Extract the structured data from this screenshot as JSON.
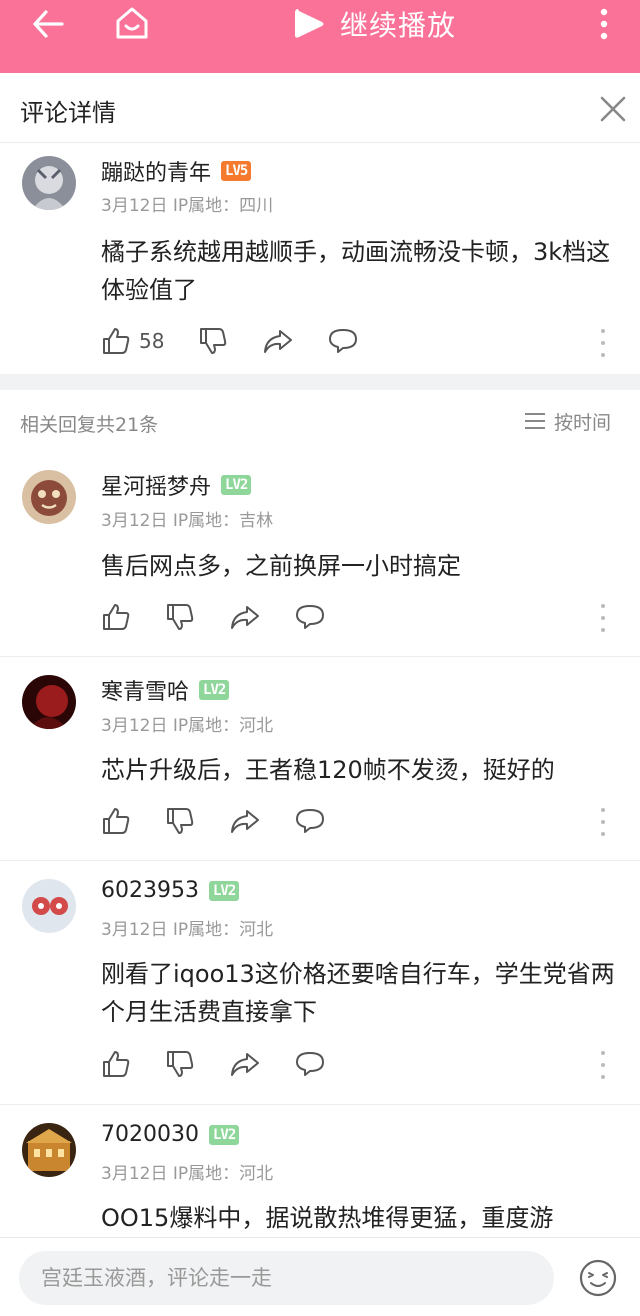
{
  "topbar": {
    "play_label": "继续播放"
  },
  "header": {
    "title": "评论详情"
  },
  "main_comment": {
    "username": "蹦跶的青年",
    "level": "LV5",
    "meta": "3月12日 IP属地：四川",
    "text": "橘子系统越用越顺手，动画流畅没卡顿，3k档这体验值了",
    "likes": "58"
  },
  "related": {
    "count_label": "相关回复共21条",
    "sort_label": "按时间"
  },
  "replies": [
    {
      "username": "星河摇梦舟",
      "level": "LV2",
      "meta": "3月12日 IP属地：吉林",
      "text": "售后网点多，之前换屏一小时搞定"
    },
    {
      "username": "寒青雪哈",
      "level": "LV2",
      "meta": "3月12日 IP属地：河北",
      "text": "芯片升级后，王者稳120帧不发烫，挺好的"
    },
    {
      "username": "6023953",
      "level": "LV2",
      "meta": "3月12日 IP属地：河北",
      "text": "刚看了iqoo13这价格还要啥自行车，学生党省两个月生活费直接拿下"
    },
    {
      "username": "7020030",
      "level": "LV2",
      "meta": "3月12日 IP属地：河北",
      "text": "OO15爆料中，据说散热堆得更猛，重度游"
    }
  ],
  "input": {
    "placeholder": "宫廷玉液酒，评论走一走"
  },
  "colors": {
    "brand_pink": "#fb7299",
    "lv5": "#f57a2e",
    "lv2": "#8fd69a"
  }
}
